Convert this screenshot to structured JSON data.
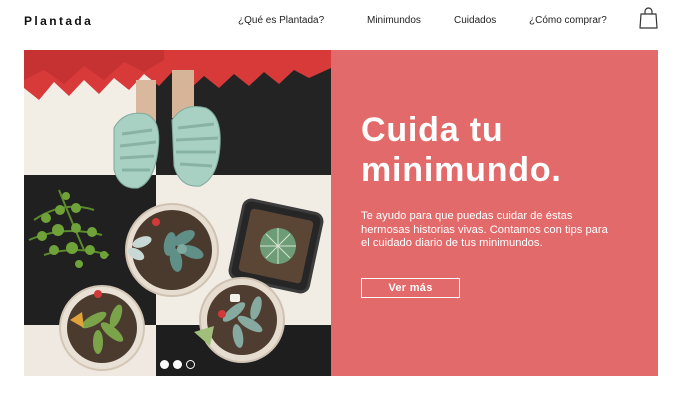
{
  "brand": {
    "name": "Plantada"
  },
  "nav": {
    "items": [
      {
        "label": "¿Qué es Plantada?"
      },
      {
        "label": "Minimundos"
      },
      {
        "label": "Cuidados"
      },
      {
        "label": "¿Cómo comprar?"
      }
    ],
    "cart_icon": "shopping-bag-icon"
  },
  "hero": {
    "title": "Cuida tu minimundo.",
    "description": "Te ayudo para que puedas cuidar de éstas hermosas historias vivas. Contamos con tips para el cuidado diario de tus minimundos.",
    "cta_label": "Ver más",
    "slides": {
      "total": 3,
      "active": [
        1,
        2
      ]
    }
  },
  "colors": {
    "accent": "#e26a6a",
    "text": "#1a1a1a",
    "background": "#ffffff",
    "sandal": "#a9d1c3"
  }
}
